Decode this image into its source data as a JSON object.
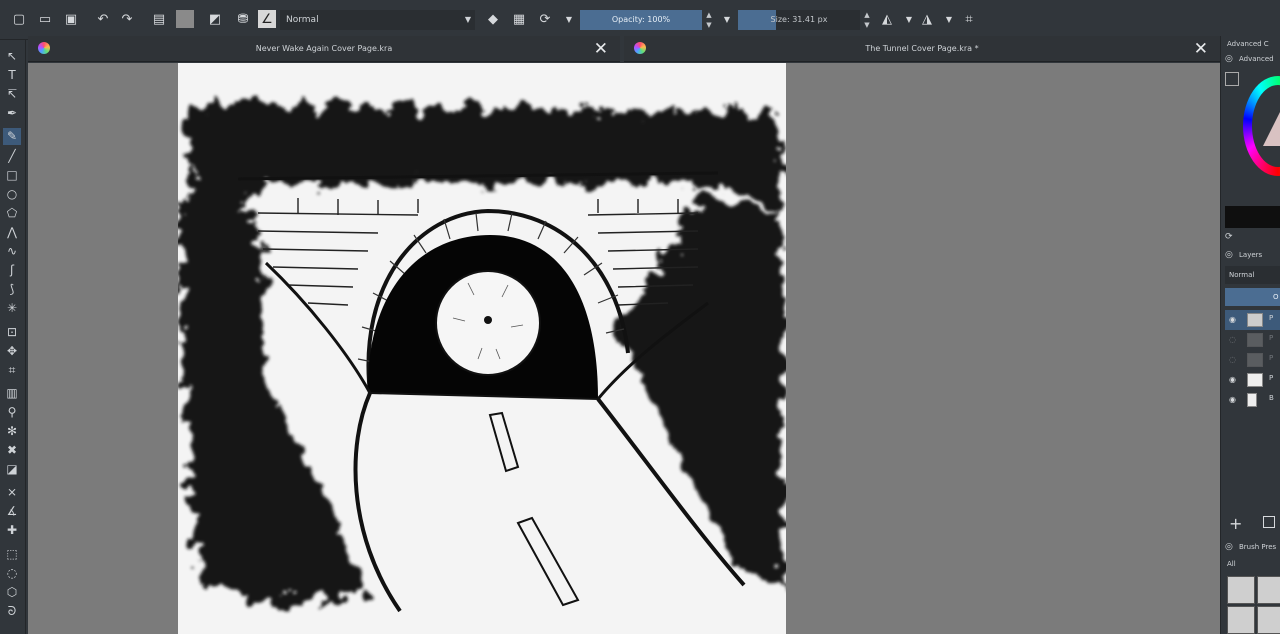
{
  "toolbar": {
    "blend_mode": "Normal",
    "opacity_label": "Opacity: 100%",
    "size_label": "Size: 31.41 px"
  },
  "documents": {
    "left": {
      "title": "Never Wake Again Cover Page.kra",
      "close": "✕"
    },
    "right": {
      "title": "The Tunnel Cover Page.kra *",
      "close": "✕"
    }
  },
  "docker": {
    "advanced_color_title": "Advanced C",
    "advanced_color_sub": "Advanced",
    "layers_title": "Layers",
    "layers_blend": "Normal",
    "layers_header": "O",
    "brush_presets_title": "Brush Pres",
    "brush_filter": "All",
    "layer_names": [
      "P",
      "P",
      "P",
      "P",
      "B"
    ]
  },
  "colors": {
    "accent": "#4b6d92",
    "panel": "#31363b",
    "canvas_bg": "#7b7b7b"
  }
}
